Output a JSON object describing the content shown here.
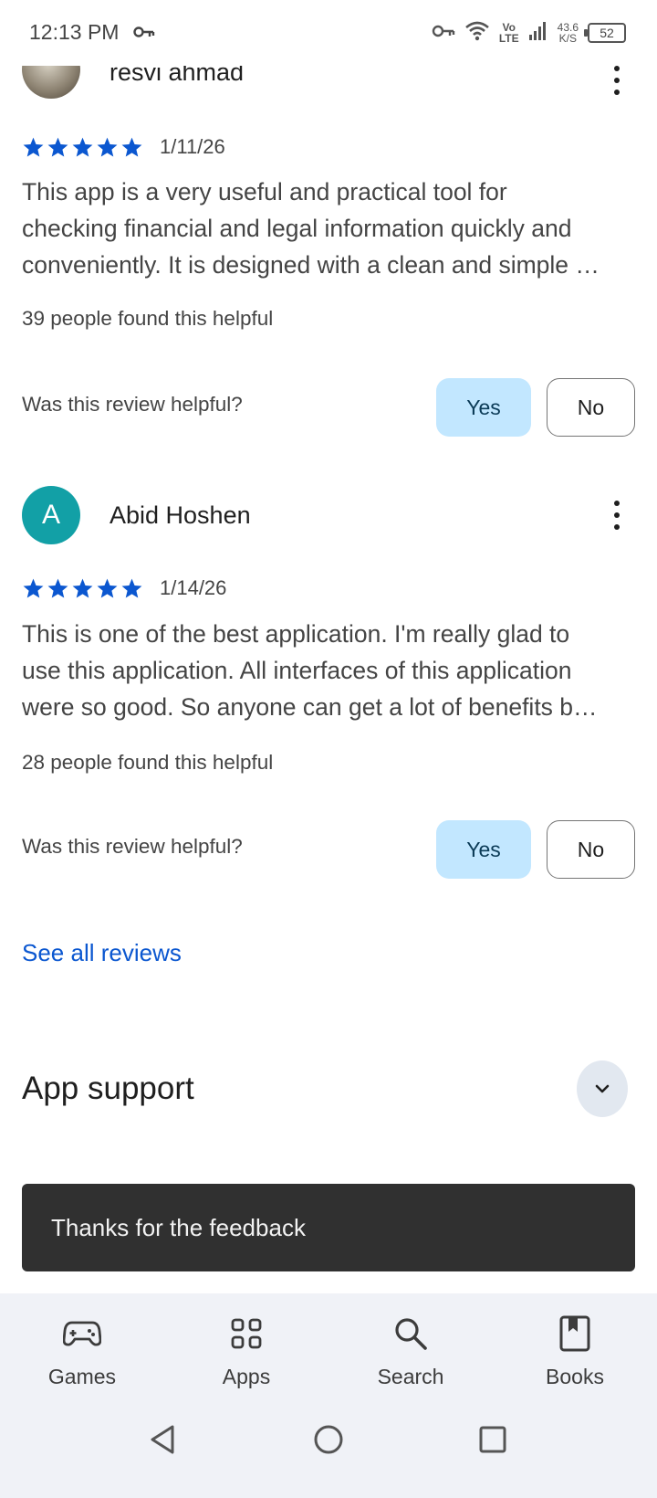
{
  "status_bar": {
    "time": "12:13 PM",
    "network_top": "Vo",
    "network_bottom": "LTE",
    "speed_value": "43.6",
    "speed_unit": "K/S",
    "battery": "52"
  },
  "reviews": [
    {
      "name": "resvi ahmad",
      "avatar_type": "photo",
      "stars": 5,
      "date": "1/11/26",
      "text_lines": [
        "This app is a very useful and practical tool for",
        "checking financial and legal information quickly and",
        "conveniently. It is designed with a clean and simple …"
      ],
      "helpful_count": "39 people found this helpful",
      "helpful_question": "Was this review helpful?",
      "yes_label": "Yes",
      "no_label": "No"
    },
    {
      "name": "Abid Hoshen",
      "avatar_letter": "A",
      "avatar_color": "#12a0a6",
      "stars": 5,
      "date": "1/14/26",
      "text_lines": [
        "This is one of the best application. I'm really glad to",
        "use this application. All interfaces of this application",
        "were so good. So anyone can get a lot of benefits b…"
      ],
      "helpful_count": "28 people found this helpful",
      "helpful_question": "Was this review helpful?",
      "yes_label": "Yes",
      "no_label": "No"
    }
  ],
  "see_all_reviews": "See all reviews",
  "app_support": {
    "title": "App support",
    "icon": "chevron-down-icon"
  },
  "snackbar": {
    "text": "Thanks for the feedback"
  },
  "bottom_nav": {
    "items": [
      {
        "label": "Games",
        "icon": "gamepad-icon"
      },
      {
        "label": "Apps",
        "icon": "apps-grid-icon"
      },
      {
        "label": "Search",
        "icon": "search-icon"
      },
      {
        "label": "Books",
        "icon": "book-icon"
      }
    ]
  },
  "system_nav": [
    "back-icon",
    "home-icon",
    "recents-icon"
  ],
  "colors": {
    "accent": "#0b57d0",
    "star": "#0b57d0",
    "yes_bg": "#c2e7ff",
    "snackbar_bg": "#303030",
    "nav_bg": "#f0f2f7"
  }
}
